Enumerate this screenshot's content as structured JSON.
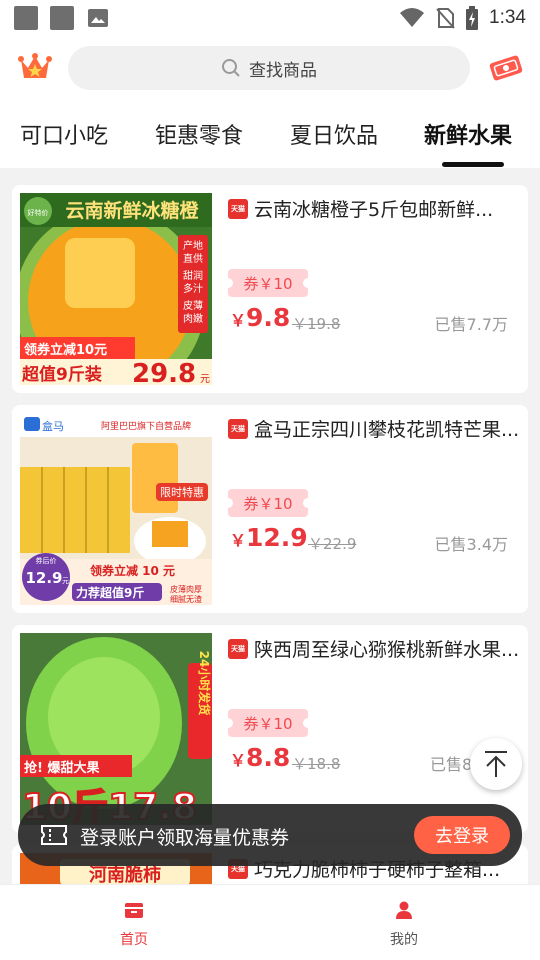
{
  "status_bar": {
    "time": "1:34"
  },
  "header": {
    "search_placeholder": "查找商品"
  },
  "tabs": [
    {
      "label": "可口小吃"
    },
    {
      "label": "钜惠零食"
    },
    {
      "label": "夏日饮品"
    },
    {
      "label": "新鲜水果",
      "active": true
    }
  ],
  "products": [
    {
      "badge": "天猫",
      "title": "云南冰糖橙子5斤包邮新鲜...",
      "coupon": "券￥10",
      "currency": "￥",
      "price": "9.8",
      "original_price": "￥19.8",
      "sold": "已售7.7万",
      "image": {
        "banner": "云南新鲜冰糖橙",
        "brand": "好特价",
        "side_lines": [
          "产地",
          "直供",
          "甜润",
          "多汁",
          "皮薄",
          "肉嫩"
        ],
        "line1": "领券立减10元",
        "line2": "超值9斤装",
        "big_price": "29.8",
        "unit": "元"
      }
    },
    {
      "badge": "天猫",
      "title": "盒马正宗四川攀枝花凯特芒果...",
      "coupon": "券￥10",
      "currency": "￥",
      "price": "12.9",
      "original_price": "￥22.9",
      "sold": "已售3.4万",
      "image": {
        "brand": "盒马",
        "banner": "阿里巴巴旗下自营品牌",
        "stamp": "限时特惠",
        "circle_top": "券后价",
        "circle_price": "12.9",
        "circle_unit": "元",
        "line1": "领券立减 10 元",
        "line2": "力荐超值9斤",
        "note1": "皮薄肉厚",
        "note2": "细腻无渣"
      }
    },
    {
      "badge": "天猫",
      "title": "陕西周至绿心猕猴桃新鲜水果...",
      "coupon": "券￥10",
      "currency": "￥",
      "price": "8.8",
      "original_price": "￥18.8",
      "sold": "已售8",
      "image": {
        "side": "24小时发货",
        "line1": "抢! 爆甜大果",
        "big": "10斤17.8"
      }
    },
    {
      "badge": "天猫",
      "title": "巧克力脆柿柿子硬柿子整箱...",
      "image": {
        "banner": "河南脆柿"
      }
    }
  ],
  "login_bar": {
    "text": "登录账户领取海量优惠券",
    "button": "去登录"
  },
  "bottom_nav": [
    {
      "label": "首页",
      "active": true,
      "color": "#e8383d"
    },
    {
      "label": "我的",
      "active": false,
      "color": "#555555"
    }
  ],
  "colors": {
    "accent": "#e8383d",
    "coupon_bg": "#ffd2d6",
    "login_button": "#ff6244"
  }
}
